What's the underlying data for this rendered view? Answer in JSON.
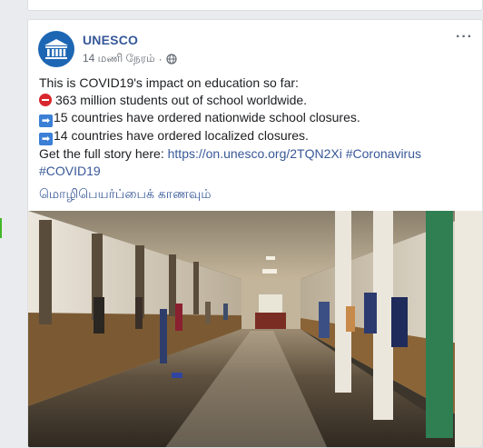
{
  "post": {
    "page_name": "UNESCO",
    "timestamp": "14 மணி நேரம்",
    "separator": "·",
    "lines": [
      "This is COVID19's impact on education so far:",
      "363 million students out of school worldwide.",
      "15 countries have ordered nationwide school closures.",
      "14 countries have ordered localized closures."
    ],
    "story_prefix": "Get the full story here: ",
    "link": "https://on.unesco.org/2TQN2Xi",
    "hashtag1": "#Coronavirus",
    "hashtag2": "#COVID19",
    "translate_label": "மொழிபெயர்ப்பைக் காணவும்",
    "more_label": "···"
  },
  "icons": {
    "avatar": "unesco-temple-logo",
    "privacy": "globe-icon",
    "line2": "no-entry-emoji",
    "line3": "right-arrow-emoji",
    "line4": "right-arrow-emoji"
  },
  "colors": {
    "link": "#385898",
    "name": "#365899",
    "avatar": "#1d66b3",
    "accent_green": "#42b72a"
  }
}
